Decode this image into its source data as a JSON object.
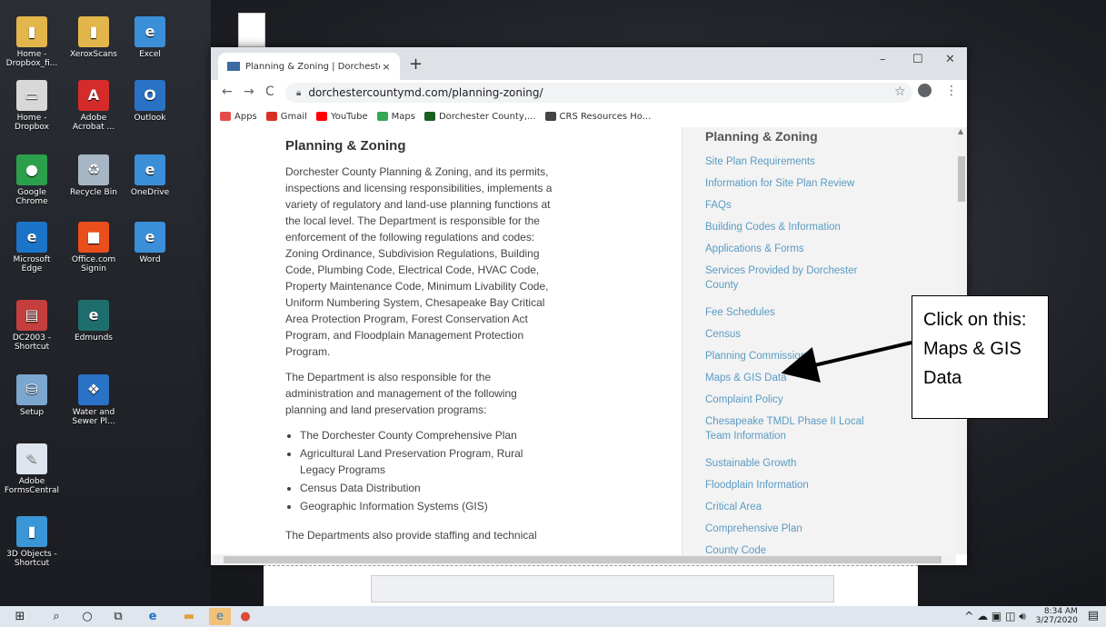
{
  "desktop": {
    "icons": [
      {
        "label": "Home - Dropbox_fi...",
        "color": "#e2b64a",
        "glyph": "▮"
      },
      {
        "label": "XeroxScans",
        "color": "#e2b64a",
        "glyph": "▮"
      },
      {
        "label": "Excel",
        "color": "#3b8fd9",
        "glyph": "e"
      },
      {
        "label": "Home - Dropbox",
        "color": "#d8d8d8",
        "glyph": "▭"
      },
      {
        "label": "Adobe Acrobat ...",
        "color": "#d62b2b",
        "glyph": "A"
      },
      {
        "label": "Outlook",
        "color": "#2a72c6",
        "glyph": "O"
      },
      {
        "label": "Google Chrome",
        "color": "#2c9f4b",
        "glyph": "●"
      },
      {
        "label": "Recycle Bin",
        "color": "#a7b6c4",
        "glyph": "♻"
      },
      {
        "label": "OneDrive",
        "color": "#3b8fd9",
        "glyph": "e"
      },
      {
        "label": "Microsoft Edge",
        "color": "#1c74c9",
        "glyph": "e"
      },
      {
        "label": "Office.com Signin",
        "color": "#e94f1c",
        "glyph": "■"
      },
      {
        "label": "Word",
        "color": "#3b8fd9",
        "glyph": "e"
      },
      {
        "label": "DC2003 - Shortcut",
        "color": "#c43e3e",
        "glyph": "▤"
      },
      {
        "label": "Edmunds",
        "color": "#1f6e6e",
        "glyph": "e"
      },
      {
        "label": "Setup",
        "color": "#7aa6cf",
        "glyph": "⛁"
      },
      {
        "label": "Water and Sewer Pl...",
        "color": "#2a72c6",
        "glyph": "❖"
      },
      {
        "label": "Adobe FormsCentral",
        "color": "#dfe5ee",
        "glyph": "✎"
      },
      {
        "label": "3D Objects - Shortcut",
        "color": "#3a96d6",
        "glyph": "▮"
      }
    ]
  },
  "browser": {
    "tab_title": "Planning & Zoning | Dorchester",
    "tab_close": "×",
    "new_tab": "+",
    "minimize": "–",
    "maximize": "☐",
    "close": "✕",
    "back": "←",
    "forward": "→",
    "reload": "C",
    "url": "dorchestercountymd.com/planning-zoning/",
    "star": "☆",
    "menu": "⋮",
    "bookmarks": [
      {
        "label": "Apps",
        "color": "#e54b4b"
      },
      {
        "label": "Gmail",
        "color": "#d93025"
      },
      {
        "label": "YouTube",
        "color": "#ff0000"
      },
      {
        "label": "Maps",
        "color": "#34a853"
      },
      {
        "label": "Dorchester County,...",
        "color": "#1b5e20"
      },
      {
        "label": "CRS Resources Ho...",
        "color": "#444444"
      }
    ]
  },
  "page": {
    "heading": "Planning & Zoning",
    "para1": "Dorchester County Planning & Zoning, and its permits, inspections and licensing responsibilities, implements a variety of regulatory and land-use planning functions at the local level. The Department is responsible for the enforcement of the following regulations and codes: Zoning Ordinance, Subdivision Regulations, Building Code, Plumbing Code, Electrical Code, HVAC Code, Property Maintenance Code, Minimum Livability Code, Uniform Numbering System, Chesapeake Bay Critical Area Protection Program, Forest Conservation Act Program, and Floodplain Management Protection Program.",
    "para2": "The Department is also responsible for the administration and management of the following planning and land preservation programs:",
    "list": [
      "The Dorchester County Comprehensive Plan",
      "Agricultural Land Preservation Program, Rural Legacy Programs",
      "Census Data Distribution",
      "Geographic Information Systems (GIS)"
    ],
    "para3": "The Departments also provide staffing and technical"
  },
  "sidebar": {
    "title": "Planning & Zoning",
    "links": [
      "Site Plan Requirements",
      "Information for Site Plan Review",
      "FAQs",
      "Building Codes & Information",
      "Applications & Forms",
      "Services Provided by Dorchester County",
      "Fee Schedules",
      "Census",
      "Planning Commission",
      "Maps & GIS Data",
      "Complaint Policy",
      "Chesapeake TMDL Phase II Local Team Information",
      "Sustainable Growth",
      "Floodplain Information",
      "Critical Area",
      "Comprehensive Plan",
      "County Code"
    ]
  },
  "callout": {
    "text": "Click on this: Maps & GIS Data"
  },
  "taskbar": {
    "time": "8:34 AM",
    "date": "3/27/2020"
  }
}
